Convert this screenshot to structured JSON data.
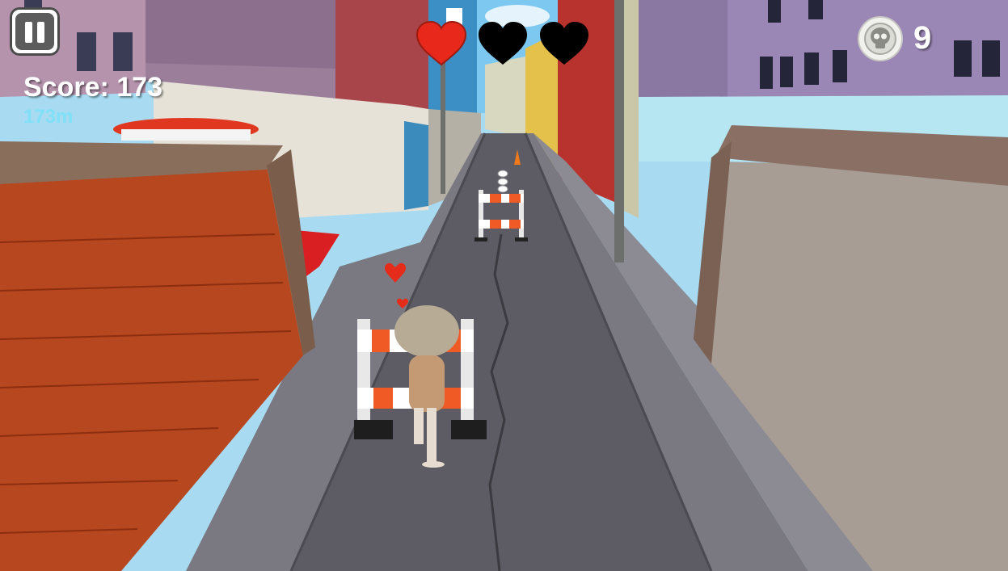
{
  "hud": {
    "pause_icon": "pause-icon",
    "score_label": "Score: 173",
    "distance_label": "173m",
    "lives": [
      {
        "state": "full",
        "color": "#e8281a"
      },
      {
        "state": "empty",
        "color": "#000000"
      },
      {
        "state": "empty",
        "color": "#000000"
      }
    ],
    "coin_icon": "skull-coin-icon",
    "coin_count": "9"
  },
  "scene": {
    "sky_color": "#9fd6ee",
    "road_color": "#5d5b63",
    "sidewalk_color": "#7b7a82",
    "brick_color": "#b6471f",
    "barrier_stripe_color": "#f05a24"
  }
}
